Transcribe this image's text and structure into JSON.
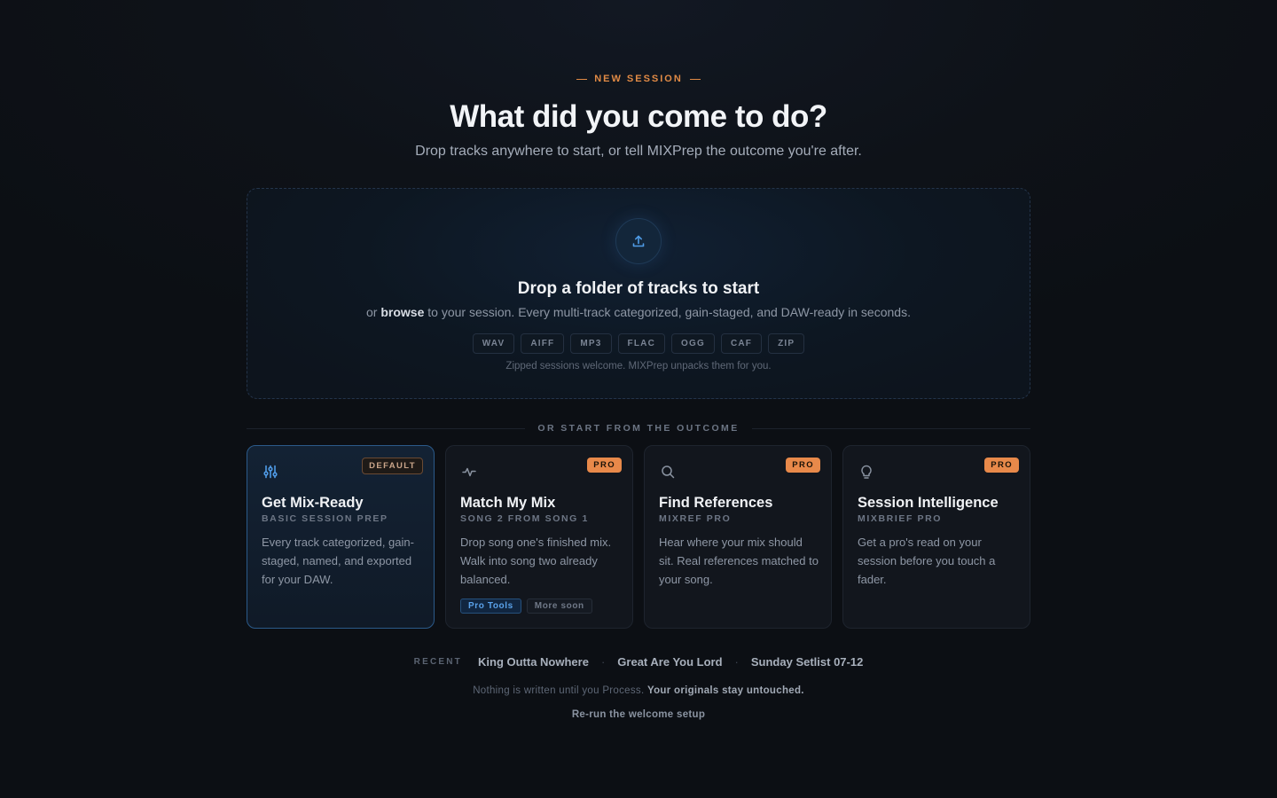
{
  "header": {
    "eyebrow": "NEW SESSION",
    "headline": "What did you come to do?",
    "subline": "Drop tracks anywhere to start, or tell MIXPrep the outcome you're after."
  },
  "dropzone": {
    "icon": "upload-icon",
    "title": "Drop a folder of tracks to start",
    "sub_prefix": "or",
    "browse_label": "browse",
    "sub_suffix": "to your session. Every multi-track categorized, gain-staged, and DAW-ready in seconds.",
    "formats": [
      "WAV",
      "AIFF",
      "MP3",
      "FLAC",
      "OGG",
      "CAF",
      "ZIP"
    ],
    "note": "Zipped sessions welcome. MIXPrep unpacks them for you."
  },
  "divider_label": "OR START FROM THE OUTCOME",
  "cards": [
    {
      "icon": "sliders-icon",
      "badge": "DEFAULT",
      "title": "Get Mix-Ready",
      "kicker": "BASIC SESSION PREP",
      "desc": "Every track categorized, gain-staged, named, and exported for your DAW."
    },
    {
      "icon": "pulse-icon",
      "badge": "PRO",
      "title": "Match My Mix",
      "kicker": "SONG 2 FROM SONG 1",
      "desc": "Drop song one's finished mix. Walk into song two already balanced.",
      "tags": [
        "Pro Tools",
        "More soon"
      ]
    },
    {
      "icon": "search-icon",
      "badge": "PRO",
      "title": "Find References",
      "kicker": "MIXREF PRO",
      "desc": "Hear where your mix should sit. Real references matched to your song."
    },
    {
      "icon": "lightbulb-icon",
      "badge": "PRO",
      "title": "Session Intelligence",
      "kicker": "MIXBRIEF PRO",
      "desc": "Get a pro's read on your session before you touch a fader."
    }
  ],
  "recent": {
    "label": "RECENT",
    "items": [
      "King Outta Nowhere",
      "Great Are You Lord",
      "Sunday Setlist 07-12"
    ],
    "separator": "·"
  },
  "footer": {
    "note_plain": "Nothing is written until you Process.",
    "note_strong": "Your originals stay untouched.",
    "rerun_label": "Re-run the welcome setup"
  },
  "colors": {
    "accent_orange": "#e8894a",
    "accent_blue": "#4f9be6",
    "background": "#0e1218"
  }
}
